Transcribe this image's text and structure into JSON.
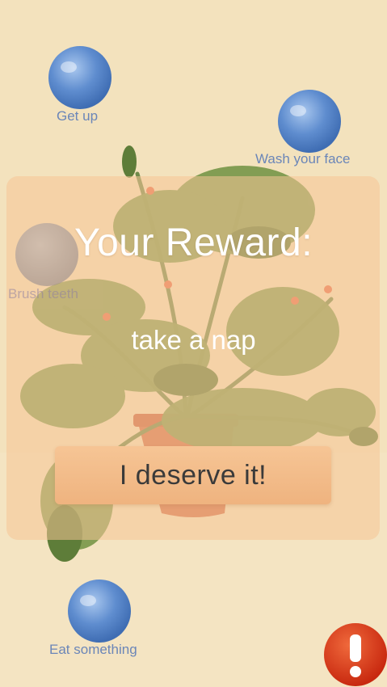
{
  "tasks": [
    {
      "label": "Get up",
      "state": "pending"
    },
    {
      "label": "Wash your face",
      "state": "pending"
    },
    {
      "label": "Brush teeth",
      "state": "dimmed"
    },
    {
      "label": "Eat something",
      "state": "pending"
    }
  ],
  "reward": {
    "title": "Your Reward:",
    "text": "take a nap",
    "button_label": "I deserve it!"
  },
  "alert": {
    "icon": "exclamation-icon"
  },
  "colors": {
    "background": "#f3e2bd",
    "bubble_blue": "#5b86c8",
    "label_blue": "#6b86b8",
    "overlay_peach": "#f6c496",
    "alert_red": "#d8361c"
  },
  "icons": [
    "monstera-plant-illustration",
    "water-bubble-icon",
    "exclamation-icon"
  ]
}
